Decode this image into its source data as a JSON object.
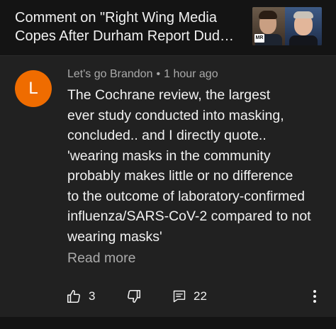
{
  "header": {
    "title": "Comment on \"Right Wing Media Copes After Durham Report Dud G...",
    "thumbnail_badge": "MR"
  },
  "comment": {
    "avatar_letter": "L",
    "avatar_color": "#ef6c00",
    "author": "Let's go Brandon",
    "separator": "•",
    "time": "1 hour ago",
    "lines": [
      "The Cochrane review, the largest",
      "ever study conducted into masking,",
      "concluded.. and I directly quote..",
      "'wearing masks in the community",
      "probably makes little or no difference",
      "to the outcome of laboratory-confirmed",
      "influenza/SARS-CoV-2 compared to not",
      "wearing masks'"
    ],
    "read_more": "Read more"
  },
  "actions": {
    "like_count": "3",
    "reply_count": "22",
    "icons": [
      "thumbs-up-icon",
      "thumbs-down-icon",
      "reply-icon",
      "more-vert-icon"
    ]
  }
}
